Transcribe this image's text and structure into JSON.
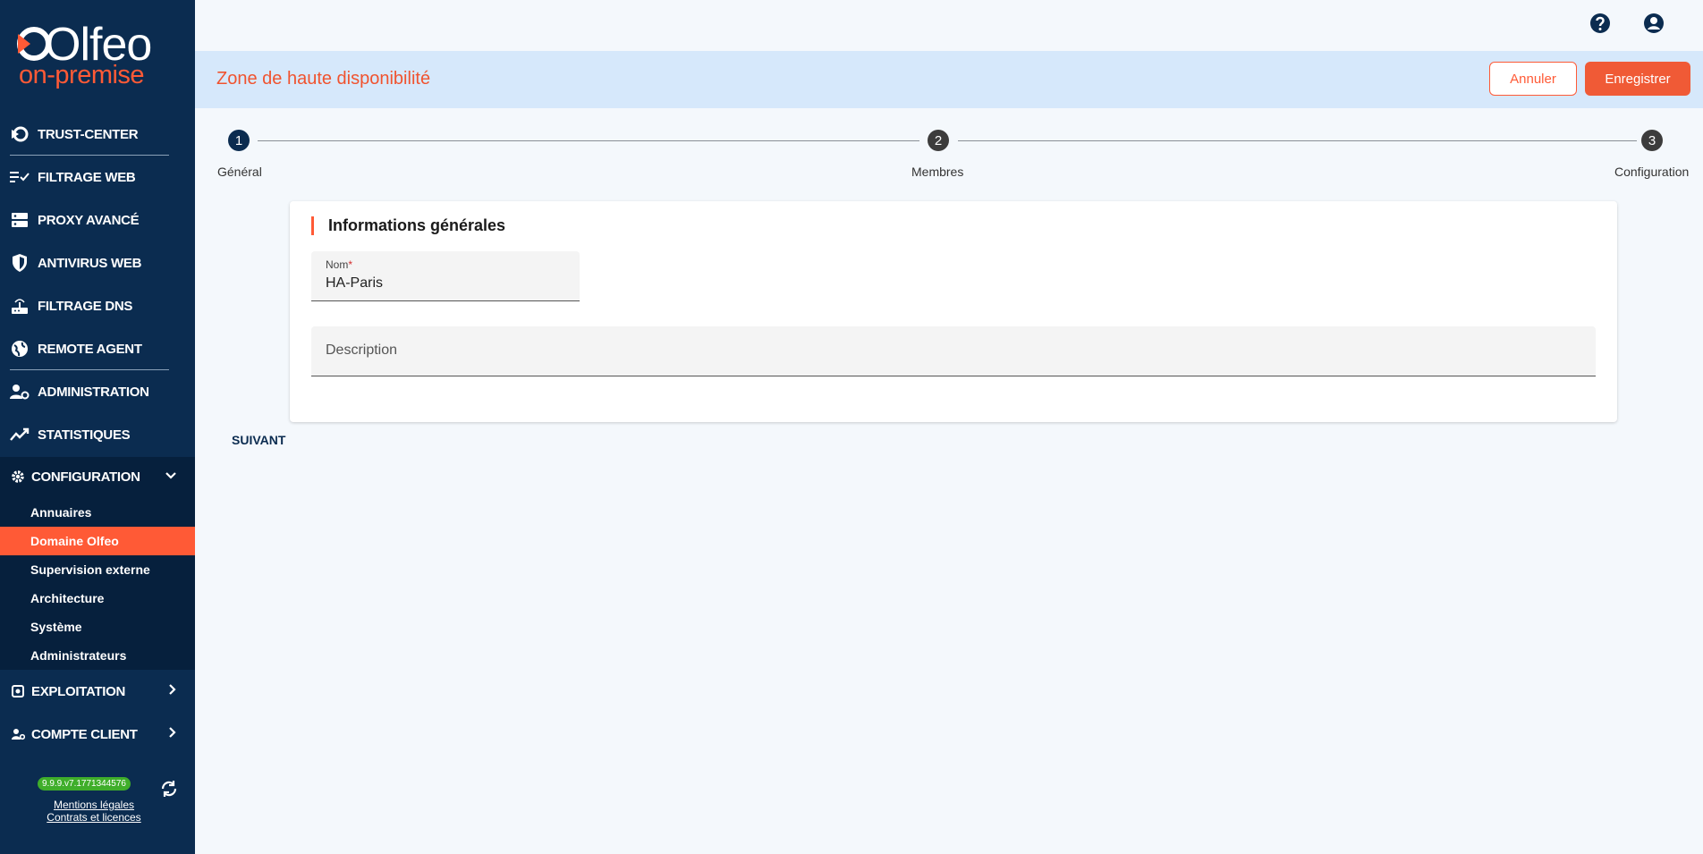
{
  "brand": {
    "name": "Olfeo",
    "sub": "on-premise"
  },
  "sidebar": {
    "items": [
      {
        "label": "TRUST-CENTER",
        "icon": "trust-center-icon"
      },
      {
        "label": "FILTRAGE WEB",
        "icon": "filter-list-icon"
      },
      {
        "label": "PROXY AVANCÉ",
        "icon": "server-icon"
      },
      {
        "label": "ANTIVIRUS WEB",
        "icon": "shield-icon"
      },
      {
        "label": "FILTRAGE DNS",
        "icon": "router-icon"
      },
      {
        "label": "REMOTE AGENT",
        "icon": "globe-icon"
      },
      {
        "label": "ADMINISTRATION",
        "icon": "user-gear-icon"
      },
      {
        "label": "STATISTIQUES",
        "icon": "trending-icon"
      }
    ],
    "configuration": {
      "label": "CONFIGURATION",
      "icon": "gear-icon",
      "sub_items": [
        "Annuaires",
        "Domaine Olfeo",
        "Supervision externe",
        "Architecture",
        "Système",
        "Administrateurs"
      ],
      "active": "Domaine Olfeo"
    },
    "exploitation": {
      "label": "EXPLOITATION",
      "icon": "cog-box-icon"
    },
    "compte_client": {
      "label": "COMPTE CLIENT",
      "icon": "customer-icon"
    },
    "version": "9.9.9.v7.1771344576",
    "legal": "Mentions légales",
    "contracts": "Contrats et licences"
  },
  "header": {
    "title": "Zone de haute disponibilité",
    "cancel_label": "Annuler",
    "save_label": "Enregistrer",
    "help_icon": "help-icon",
    "account_icon": "account-icon"
  },
  "stepper": {
    "steps": [
      {
        "number": "1",
        "label": "Général",
        "active": true
      },
      {
        "number": "2",
        "label": "Membres",
        "active": false
      },
      {
        "number": "3",
        "label": "Configuration",
        "active": false
      }
    ]
  },
  "form": {
    "section_title": "Informations générales",
    "name_label": "Nom",
    "name_required": "*",
    "name_value": "HA-Paris",
    "description_label": "Description",
    "next_label": "SUIVANT"
  },
  "colors": {
    "sidebar": "#0b2c50",
    "accent": "#ff5a36",
    "header_band": "#d6e8fb"
  }
}
